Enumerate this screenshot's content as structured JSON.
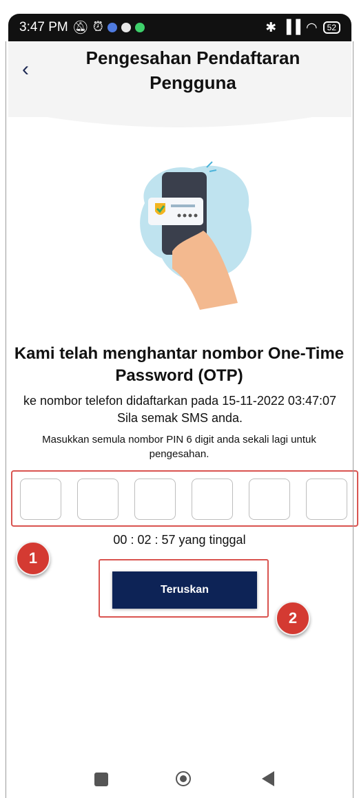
{
  "status_bar": {
    "time": "3:47 PM",
    "battery": "52"
  },
  "header": {
    "title_line1": "Pengesahan Pendaftaran",
    "title_line2": "Pengguna",
    "back_icon": "chevron-left-icon"
  },
  "content": {
    "heading": "Kami telah menghantar nombor One-Time Password (OTP)",
    "info_line1": "ke nombor telefon didaftarkan pada 15-11-2022 03:47:07",
    "info_line2": "Sila semak SMS anda.",
    "instruction": "Masukkan semula nombor PIN 6 digit anda sekali lagi untuk pengesahan.",
    "otp_boxes": [
      "",
      "",
      "",
      "",
      "",
      ""
    ],
    "timer": "00 : 02 : 57 yang tinggal",
    "continue_button": "Teruskan"
  },
  "annotations": {
    "badge1": "1",
    "badge2": "2",
    "highlight_color": "#d9534f"
  },
  "colors": {
    "primary": "#0d2356",
    "annotation": "#d43a32"
  }
}
